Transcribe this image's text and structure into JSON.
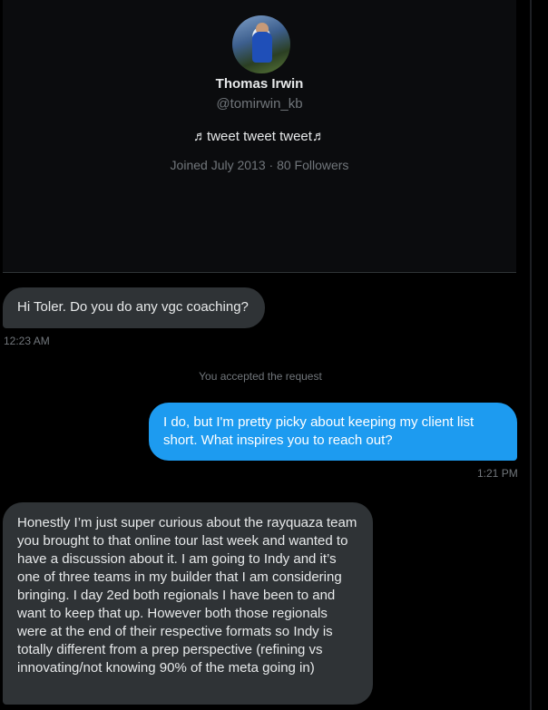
{
  "profile": {
    "name": "Thomas Irwin",
    "handle": "@tomirwin_kb",
    "bio": "♬tweet tweet tweet♬",
    "joined": "Joined July 2013 · 80 Followers"
  },
  "messages": [
    {
      "direction": "received",
      "text": "Hi Toler. Do you do any vgc coaching?",
      "time": "12:23 AM"
    },
    {
      "direction": "sent",
      "text": "I do, but I'm pretty picky about keeping my client list short. What inspires you to reach out?",
      "time": "1:21 PM"
    },
    {
      "direction": "received",
      "text": "Honestly I’m just super curious about the rayquaza team you brought to that online tour last week and wanted to have a discussion about it. I am going to Indy and it’s one of three teams in my builder that I am considering bringing. I day 2ed both regionals I have been to and want to keep that up. However both those regionals were at the end of their respective formats so Indy is totally different from a prep perspective (refining vs innovating/not knowing 90% of the meta going in)",
      "time": ""
    }
  ],
  "system_note": "You accepted the request",
  "colors": {
    "sent_bubble": "#1d9bf0",
    "received_bubble": "#2f3336",
    "background": "#000000",
    "muted_text": "#71767b"
  }
}
